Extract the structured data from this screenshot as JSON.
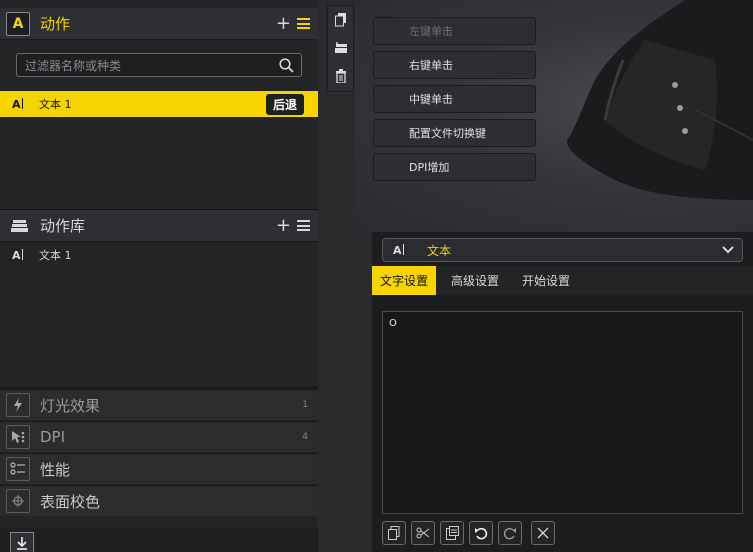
{
  "actions_panel": {
    "title": "动作",
    "icon_letter": "A",
    "search_placeholder": "过滤器名称或种类",
    "items": [
      {
        "label": "文本 1",
        "selected": true,
        "badge": "后退"
      }
    ]
  },
  "library_panel": {
    "title": "动作库",
    "items": [
      {
        "label": "文本 1"
      }
    ]
  },
  "categories": [
    {
      "label": "灯光效果",
      "count": "1",
      "icon": "lightning-icon"
    },
    {
      "label": "DPI",
      "count": "4",
      "icon": "dpi-pointer-icon"
    },
    {
      "label": "性能",
      "count": "",
      "icon": "performance-sliders-icon"
    },
    {
      "label": "表面校色",
      "count": "",
      "icon": "crosshair-icon"
    }
  ],
  "tool_strip": [
    "copy-icon",
    "add-to-library-icon",
    "trash-icon"
  ],
  "button_assignments": [
    {
      "label": "左键单击",
      "disabled": true
    },
    {
      "label": "右键单击",
      "disabled": false
    },
    {
      "label": "中键单击",
      "disabled": false
    },
    {
      "label": "配置文件切换键",
      "disabled": false
    },
    {
      "label": "DPI增加",
      "disabled": false
    }
  ],
  "editor": {
    "type_label": "文本",
    "tabs": [
      {
        "label": "文字设置",
        "active": true
      },
      {
        "label": "高级设置",
        "active": false
      },
      {
        "label": "开始设置",
        "active": false
      }
    ],
    "text_value": "O",
    "toolbar": [
      "copy-icon",
      "cut-icon",
      "paste-icon",
      "undo-icon",
      "redo-icon",
      "clear-icon"
    ]
  },
  "colors": {
    "accent": "#f5d400",
    "panel": "#232426",
    "background": "#2a2b2d"
  }
}
